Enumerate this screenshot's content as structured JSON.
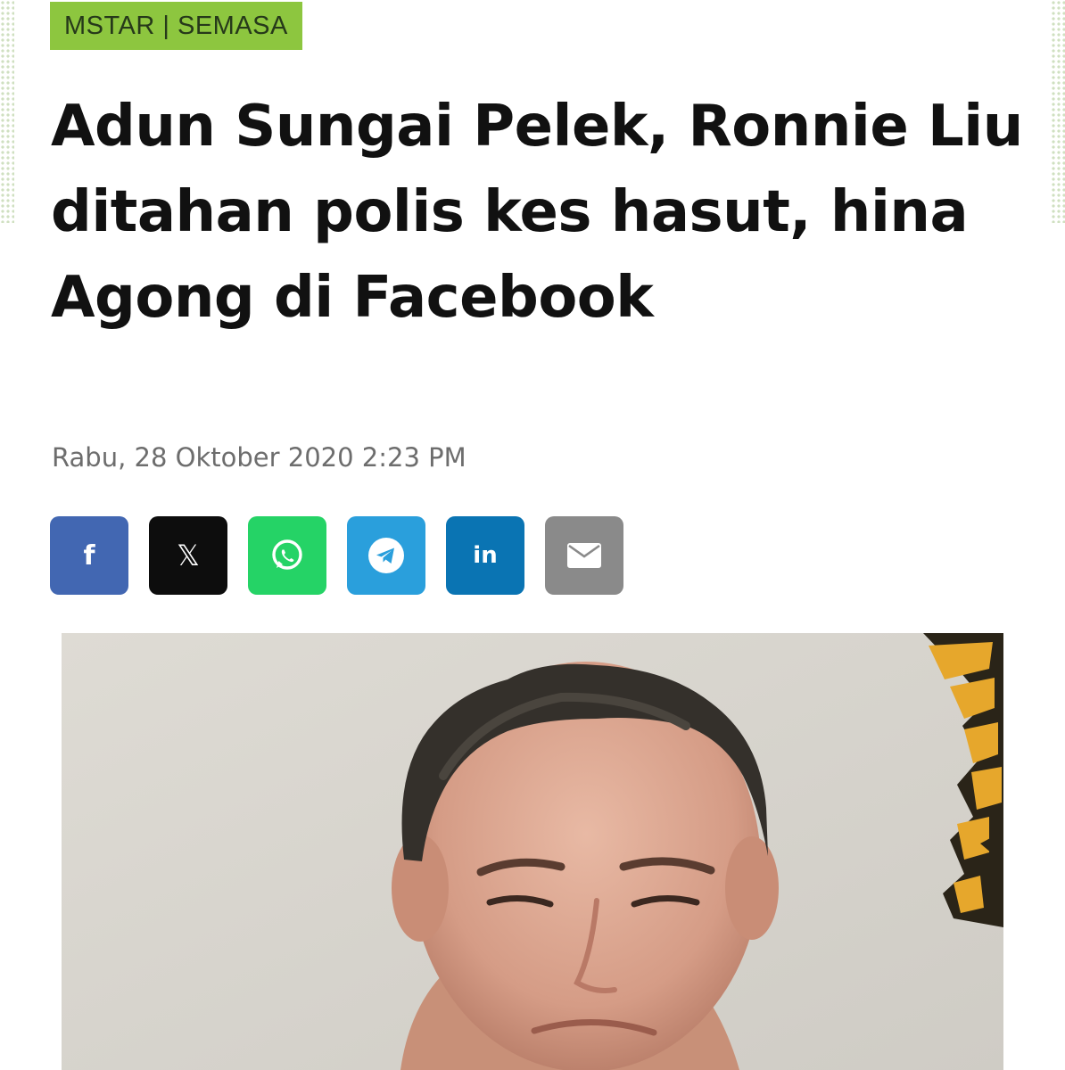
{
  "article": {
    "category": "MSTAR | SEMASA",
    "headline": "Adun Sungai Pelek, Ronnie Liu ditahan polis kes hasut, hina Agong di Facebook",
    "date": "Rabu, 28 Oktober 2020 2:23 PM"
  },
  "share_buttons": [
    {
      "name": "facebook",
      "label": "f",
      "icon": "facebook-icon",
      "color": "#4267b2"
    },
    {
      "name": "x",
      "label": "𝕏",
      "icon": "x-icon",
      "color": "#0d0d0d"
    },
    {
      "name": "whatsapp",
      "icon": "whatsapp-icon",
      "color": "#25d366"
    },
    {
      "name": "telegram",
      "icon": "telegram-icon",
      "color": "#2a9fdc"
    },
    {
      "name": "linkedin",
      "label": "in",
      "icon": "linkedin-icon",
      "color": "#0a74b3"
    },
    {
      "name": "email",
      "icon": "email-icon",
      "color": "#8a8a8a"
    }
  ],
  "colors": {
    "category_bg": "#8dc63f",
    "headline": "#111111",
    "date": "#6d6d6d"
  }
}
